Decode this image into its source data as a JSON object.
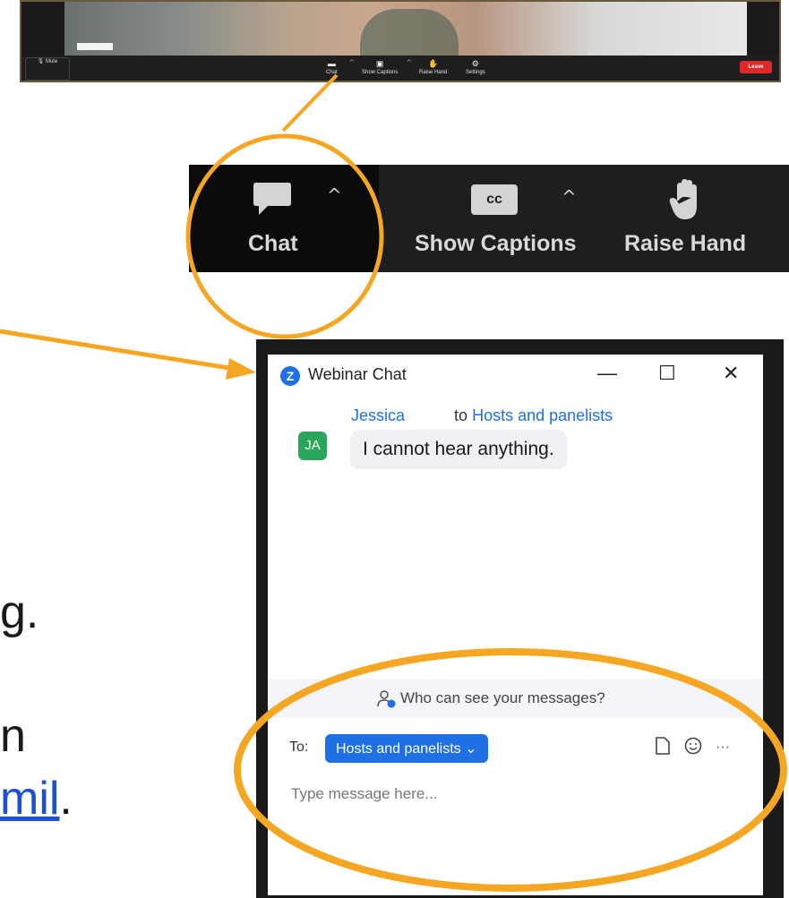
{
  "mini_toolbar": {
    "mute_label": "Mute",
    "chat_label": "Chat",
    "captions_label": "Show Captions",
    "raise_hand_label": "Raise Hand",
    "settings_label": "Settings",
    "leave_label": "Leave"
  },
  "toolbar": {
    "chat_label": "Chat",
    "captions_label": "Show Captions",
    "cc_badge": "cc",
    "raise_hand_label": "Raise Hand"
  },
  "slide": {
    "line1": "g.",
    "line2": "n",
    "link_text": "mil",
    "line3_suffix": "."
  },
  "chat_window": {
    "title": "Webinar Chat",
    "minimize": "—",
    "maximize": "☐",
    "close": "✕",
    "message": {
      "sender": "Jessica",
      "recipient_prefix": "to",
      "recipient": "Hosts and panelists",
      "avatar_initials": "JA",
      "text": "I cannot hear anything."
    },
    "who_can_see": "Who can see your messages?",
    "to_label": "To:",
    "to_value": "Hosts and panelists",
    "placeholder": "Type message here...",
    "more": "···"
  },
  "colors": {
    "highlight": "#f5a623",
    "zoom_blue": "#1f6fe5",
    "leave_red": "#e02828"
  }
}
